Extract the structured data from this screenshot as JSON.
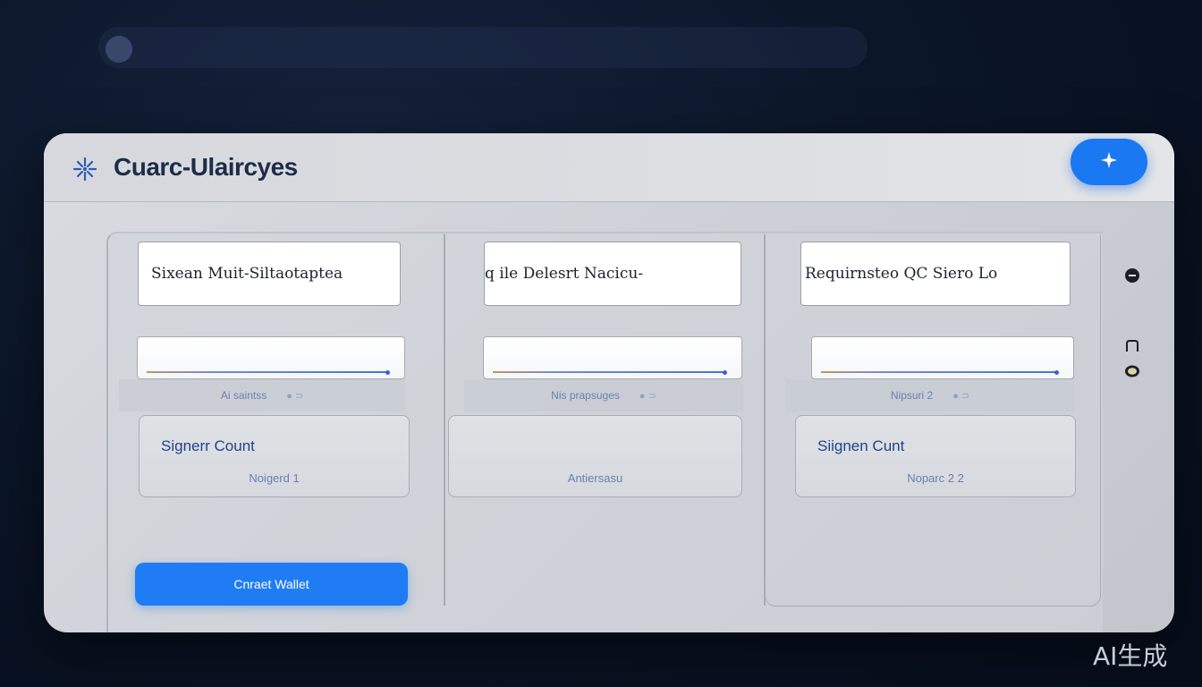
{
  "app": {
    "title": "Cuarc-Ulaircyes",
    "accent_color": "#1a78f2",
    "logo_icon": "sparkle-icon",
    "fab_icon": "star-icon"
  },
  "columns": [
    {
      "title": "Sixean Muit-Siltaotaptea",
      "hint": "Ai saintss",
      "signer": {
        "title": "Signerr Count",
        "subtitle": "Noigerd 1"
      }
    },
    {
      "title": "q ile Delesrt Nacicu-",
      "hint": "Nis prapsuges",
      "signer": {
        "title": "",
        "subtitle": "Antiersasu"
      }
    },
    {
      "title": "Requirnsteo QC Siero Lo",
      "hint": "Nipsuri 2",
      "signer": {
        "title": "Siignen Cunt",
        "subtitle": "Noparc 2 2"
      }
    }
  ],
  "actions": {
    "create_label": "Cnraet Wallet"
  },
  "side_icons": [
    "shield-icon",
    "device-icon",
    "coin-icon"
  ],
  "watermark": "AI生成"
}
